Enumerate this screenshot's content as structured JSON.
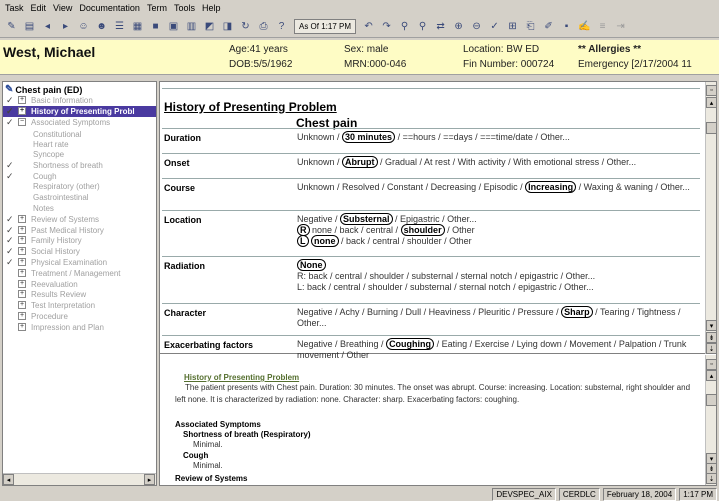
{
  "menu": [
    "Task",
    "Edit",
    "View",
    "Documentation",
    "Term",
    "Tools",
    "Help"
  ],
  "toolbar": {
    "asof": "As Of 1:17 PM"
  },
  "banner": {
    "name": "West, Michael",
    "age": "Age:41 years",
    "dob": "DOB:5/5/1962",
    "sex": "Sex: male",
    "mrn": "MRN:000-046",
    "location": "Location: BW ED",
    "fin": "Fin Number: 000724",
    "allergies": "** Allergies **",
    "emergency": "Emergency [2/17/2004 11"
  },
  "tree": {
    "root": "Chest pain (ED)",
    "items": [
      {
        "label": "Basic Information",
        "checked": true
      },
      {
        "label": "History of Presenting Probl",
        "checked": true,
        "selected": true
      },
      {
        "label": "Associated Symptoms",
        "checked": true
      },
      {
        "label": "Constitutional"
      },
      {
        "label": "Heart rate"
      },
      {
        "label": "Syncope"
      },
      {
        "label": "Shortness of breath",
        "checked": true
      },
      {
        "label": "Cough",
        "checked": true
      },
      {
        "label": "Respiratory (other)"
      },
      {
        "label": "Gastrointestinal"
      },
      {
        "label": "Notes"
      },
      {
        "label": "Review of Systems",
        "checked": true
      },
      {
        "label": "Past Medical History",
        "checked": true
      },
      {
        "label": "Family History",
        "checked": true
      },
      {
        "label": "Social History",
        "checked": true
      },
      {
        "label": "Physical Examination",
        "checked": true
      },
      {
        "label": "Treatment / Management"
      },
      {
        "label": "Reevaluation"
      },
      {
        "label": "Results Review"
      },
      {
        "label": "Test Interpretation"
      },
      {
        "label": "Procedure"
      },
      {
        "label": "Impression and Plan"
      }
    ]
  },
  "doc": {
    "heading": "History of Presenting Problem",
    "subheading": "Chest pain",
    "rows": [
      {
        "label": "Duration",
        "text": "Unknown / <span class=\"circ\">30 minutes</span> / ==hours / ==days / ===time/date / Other..."
      },
      {
        "label": "Onset",
        "text": "Unknown / <span class=\"circ\">Abrupt</span> / Gradual / At rest / With activity / With emotional stress / Other..."
      },
      {
        "label": "Course",
        "text": "Unknown / Resolved / Constant / Decreasing / Episodic / <span class=\"circ\">Increasing</span> / Waxing &amp; waning / Other..."
      },
      {
        "label": "Location",
        "text": "Negative / <span class=\"circ\">Substernal</span> / Epigastric / Other...<br><span class=\"circ\">R</span> none / back / central / <span class=\"circ\">shoulder</span> / Other<br><span class=\"circ\">L</span> <span class=\"circ\">none</span> / back / central / shoulder / Other"
      },
      {
        "label": "Radiation",
        "text": "<span class=\"circ\">None</span><br>R: back / central / shoulder / substernal / sternal notch / epigastric / Other...<br>L: back / central / shoulder / substernal / sternal notch / epigastric / Other..."
      },
      {
        "label": "Character",
        "text": "Negative / Achy / Burning / Dull / Heaviness / Pleuritic / Pressure / <span class=\"circ\">Sharp</span> / Tearing / Tightness / Other..."
      },
      {
        "label": "Exacerbating factors",
        "text": "Negative / Breathing / <span class=\"circ\">Coughing</span> / Eating / Exercise / Lying down / Movement / Palpation / Trunk movement / Other"
      }
    ]
  },
  "summary": {
    "heading": "History of Presenting Problem",
    "para": "The patient presents with Chest pain. Duration: 30 minutes. The onset was abrupt. Course: increasing. Location: substernal, right shoulder and left none. It is characterized by radiation: none. Character: sharp. Exacerbating factors: coughing.",
    "assoc": "Associated Symptoms",
    "sob": "Shortness of breath (Respiratory)",
    "sob_val": "Minimal.",
    "cough": "Cough",
    "cough_val": "Minimal.",
    "ros": "Review of Systems"
  },
  "status": [
    "DEVSPEC_AIX",
    "CERDLC",
    "February 18, 2004",
    "1:17 PM"
  ]
}
